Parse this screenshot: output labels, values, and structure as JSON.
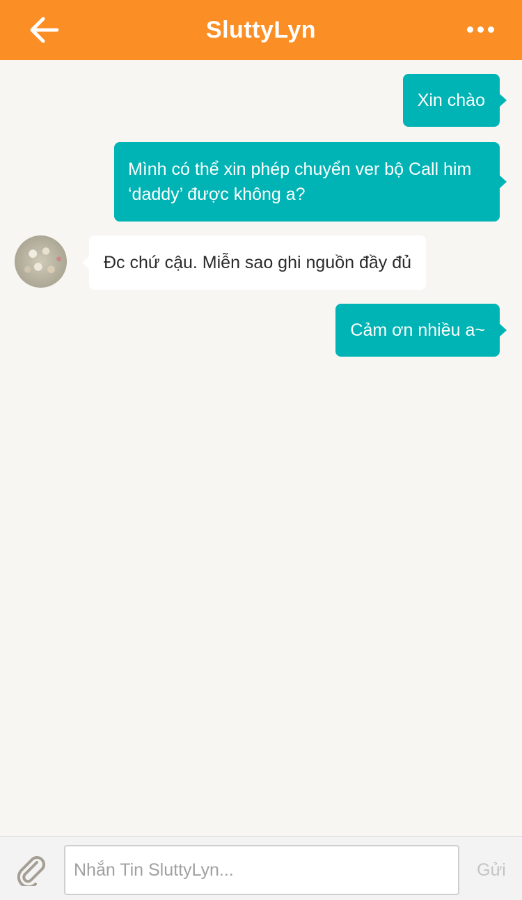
{
  "header": {
    "title": "SluttyLyn",
    "back_icon": "arrow-left-icon",
    "more_icon": "more-horizontal-icon"
  },
  "messages": [
    {
      "direction": "out",
      "text": "Xin chào"
    },
    {
      "direction": "out",
      "text": "Mình có thể xin phép chuyển ver bộ Call him ‘daddy’ được không a?"
    },
    {
      "direction": "in",
      "text": "Đc chứ cậu. Miễn sao ghi nguồn đầy đủ"
    },
    {
      "direction": "out",
      "text": "Cảm ơn nhiều a~"
    }
  ],
  "composer": {
    "attach_icon": "paperclip-icon",
    "input_value": "",
    "placeholder": "Nhắn Tin SluttyLyn...",
    "send_label": "Gửi"
  },
  "colors": {
    "header": "#fb8f26",
    "outgoing_bubble": "#00b3b4",
    "incoming_bubble": "#ffffff",
    "background": "#f7f6f2"
  }
}
